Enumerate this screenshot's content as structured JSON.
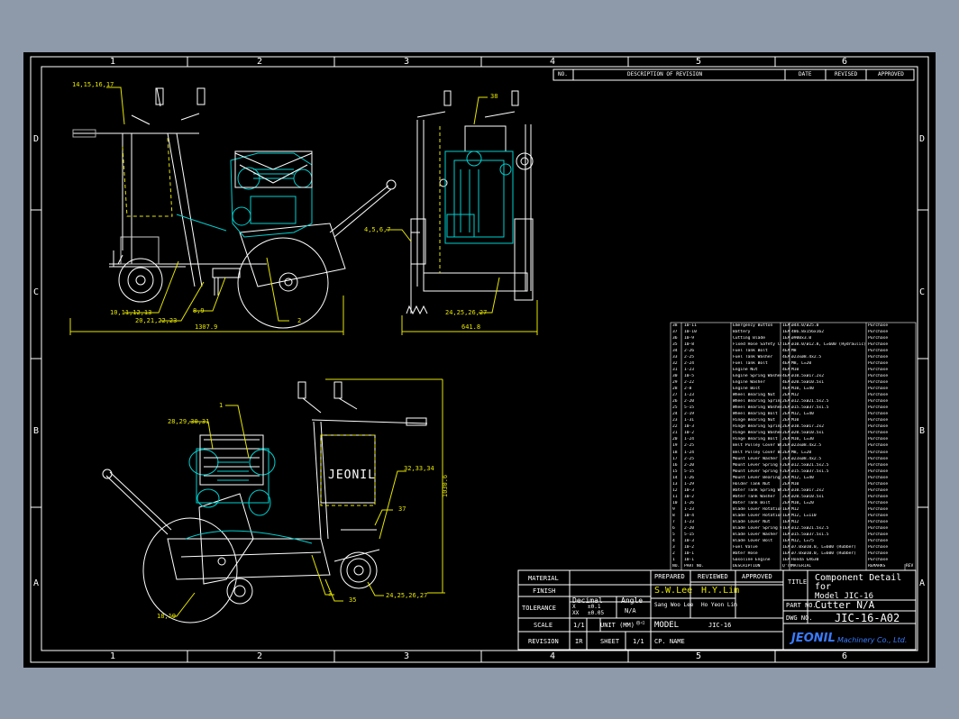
{
  "grid": {
    "columns": [
      "1",
      "2",
      "3",
      "4",
      "5",
      "6"
    ],
    "rows": [
      "D",
      "C",
      "B",
      "A"
    ]
  },
  "revision_header": {
    "no": "NO.",
    "description": "DESCRIPTION OF REVISION",
    "date": "DATE",
    "revised": "REVISED",
    "approved": "APPROVED"
  },
  "callouts": {
    "c1": "14,15,16,17",
    "c2": "38",
    "c3": "4,5,6,7",
    "c4": "10,11,12,13",
    "c5": "20,21,22,23",
    "c6": "8,9",
    "c7": "2",
    "c8": "24,25,26,27",
    "c9": "1",
    "c10": "28,29,30,31",
    "c11": "32,33,34",
    "c12": "37",
    "c13": "3",
    "c14": "35",
    "c15": "24,25,26,27",
    "c16": "18,19"
  },
  "dimensions": {
    "width_side": "1307.9",
    "width_front": "641.8",
    "height": "1030.6"
  },
  "brand_on_tank": "JEONIL",
  "bom_rows": [
    [
      "38",
      "10-11",
      "Emergency Button",
      "1EA",
      "ø44.0/ø25.0",
      "Purchase"
    ],
    [
      "37",
      "10-10",
      "Battery",
      "1EA",
      "486.8x156x162",
      "Purchase"
    ],
    [
      "36",
      "10-9",
      "Cutting Blade",
      "1EA",
      "ø900x3.0",
      "Purchase"
    ],
    [
      "35",
      "10-8",
      "Fixed Hose Safety Chain",
      "1EA",
      "ø10.0/ø12.8, L=600 (Hydraulic)",
      "Purchase"
    ],
    [
      "34",
      "2-26",
      "Fuel Tank Bolt",
      "4EA",
      "M8",
      "Purchase"
    ],
    [
      "33",
      "2-25",
      "Fuel Tank Washer",
      "4EA",
      "ø23xø8.4x2.5",
      "Purchase"
    ],
    [
      "32",
      "2-24",
      "Fuel Tank Bolt",
      "4EA",
      "M8, L=20",
      "Purchase"
    ],
    [
      "31",
      "1-23",
      "Engine Nut",
      "4EA",
      "M10",
      "Purchase"
    ],
    [
      "30",
      "10-5",
      "Engine Spring Washer",
      "4EA",
      "ø10.5xø17.2x2",
      "Purchase"
    ],
    [
      "29",
      "2-22",
      "Engine Washer",
      "4EA",
      "ø20.5xø10.5x1",
      "Purchase"
    ],
    [
      "28",
      "2-8",
      "Engine Bolt",
      "4EA",
      "M10, L=40",
      "Purchase"
    ],
    [
      "27",
      "1-23",
      "Wheel Bearing Nut",
      "2EA",
      "M12",
      "Purchase"
    ],
    [
      "26",
      "2-20",
      "Wheel Bearing Spring Washer",
      "2EA",
      "ø12.5xø21.5x2.5",
      "Purchase"
    ],
    [
      "25",
      "5-15",
      "Wheel Bearing Washer",
      "2EA",
      "ø15.5xø37.5x1.5",
      "Purchase"
    ],
    [
      "24",
      "2-19",
      "Wheel Bearing Bolt",
      "2EA",
      "M12, L=40",
      "Purchase"
    ],
    [
      "23",
      "1-31",
      "Hinge Bearing Nut",
      "2EA",
      "M10",
      "Purchase"
    ],
    [
      "22",
      "10-3",
      "Hinge Bearing Spring Washer",
      "2EA",
      "ø10.5xø17.2x2",
      "Purchase"
    ],
    [
      "21",
      "10-2",
      "Hinge Bearing Washer",
      "2EA",
      "ø20.5xø10.5x1",
      "Purchase"
    ],
    [
      "20",
      "1-24",
      "Hinge Bearing Bolt",
      "2EA",
      "M10, L=30",
      "Purchase"
    ],
    [
      "19",
      "2-25",
      "Belt Pulley Cover Washer",
      "2EA",
      "ø23xø8.4x2.5",
      "Purchase"
    ],
    [
      "18",
      "1-24",
      "Belt Pulley Cover Bolt",
      "2EA",
      "M8, L=20",
      "Purchase"
    ],
    [
      "17",
      "2-25",
      "Mount Lever Washer",
      "2EA",
      "ø23xø8.4x2.5",
      "Purchase"
    ],
    [
      "16",
      "2-20",
      "Mount Lever Spring Washer",
      "2EA",
      "ø12.5xø21.5x2.5",
      "Purchase"
    ],
    [
      "15",
      "5-15",
      "Mount Lever Spring Washer",
      "2EA",
      "ø15.5xø37.5x1.5",
      "Purchase"
    ],
    [
      "14",
      "1-26",
      "Mount Lever Bearing Bolt",
      "2EA",
      "M12, L=40",
      "Purchase"
    ],
    [
      "13",
      "1-29",
      "Holder Tank Nut",
      "2EA",
      "M10",
      "Purchase"
    ],
    [
      "12",
      "10-3",
      "Water Tank Spring Washer",
      "2EA",
      "ø10.5xø17.2x2",
      "Purchase"
    ],
    [
      "11",
      "10-2",
      "Water Tank Washer",
      "2EA",
      "ø20.5xø10.5x1",
      "Purchase"
    ],
    [
      "10",
      "1-26",
      "Water Tank Bolt",
      "2EA",
      "M10, L=20",
      "Purchase"
    ],
    [
      "9",
      "1-23",
      "Blade Cover Rotation Nut",
      "1EA",
      "M12",
      "Purchase"
    ],
    [
      "8",
      "10-4",
      "Blade Cover Rotation Bolt",
      "1EA",
      "M12, L=110",
      "Purchase"
    ],
    [
      "7",
      "1-23",
      "Blade Cover Nut",
      "1EA",
      "M12",
      "Purchase"
    ],
    [
      "6",
      "2-20",
      "Blade Cover Spring Washer",
      "1EA",
      "ø12.5xø21.5x2.5",
      "Purchase"
    ],
    [
      "5",
      "5-15",
      "Blade Cover Washer",
      "1EA",
      "ø15.5xø37.5x1.5",
      "Purchase"
    ],
    [
      "4",
      "10-3",
      "Blade Cover Bolt",
      "1EA",
      "M12, L=75",
      "Purchase"
    ],
    [
      "3",
      "10-2",
      "Fuel Valve",
      "1EA",
      "ø7.0xø10.0, L=600 (Rubber)",
      "Purchase"
    ],
    [
      "2",
      "10-1",
      "Water Hose",
      "1EA",
      "ø7.0xø10.0, L=600 (Rubber)",
      "Purchase"
    ],
    [
      "1",
      "10-1",
      "Gasoline Engine",
      "1EA",
      "Honda GX630",
      "Purchase"
    ],
    [
      "NO.",
      "PART NO.",
      "DESCRIPTION",
      "Q'TY",
      "MATERIAL",
      "REMARKS"
    ]
  ],
  "bom_trailing": "REV",
  "title_block": {
    "material_label": "MATERIAL",
    "finish_label": "FINISH",
    "tolerance_label": "TOLERANCE",
    "decimal_label": "Decimal",
    "angle_label": "Angle",
    "tol_x": "X",
    "tol_x_val": "±0.1",
    "tol_xx": "XX",
    "tol_xx_val": "±0.05",
    "angle_val": "N/A",
    "scale_label": "SCALE",
    "scale_val": "1/1",
    "unit_label": "UNIT (MM)",
    "revision_label": "REVISION",
    "revision_val": "IR",
    "sheet_label": "SHEET",
    "sheet_val": "1/1",
    "prepared_label": "PREPARED",
    "reviewed_label": "REVIEWED",
    "approved_label": "APPROVED",
    "prepared_name": "S.W.Lee",
    "reviewed_name": "H.Y.Lim",
    "prepared_full": "Sang Woo Lee",
    "reviewed_full": "Ho Yeon Lim",
    "model_label": "MODEL",
    "model_val": "JIC-16",
    "cp_name_label": "CP. NAME",
    "title_label": "TITLE",
    "title_line1": "Component Detail",
    "title_line2": "for",
    "title_line3": "Model JIC-16",
    "title_line4": "Cutter N/A",
    "part_no_label": "PART NO.",
    "dwg_no_label": "DWG NO.",
    "dwg_no_val": "JIC-16-A02",
    "company_logo": "JEONIL",
    "company_name": "Machinery Co., Ltd."
  }
}
